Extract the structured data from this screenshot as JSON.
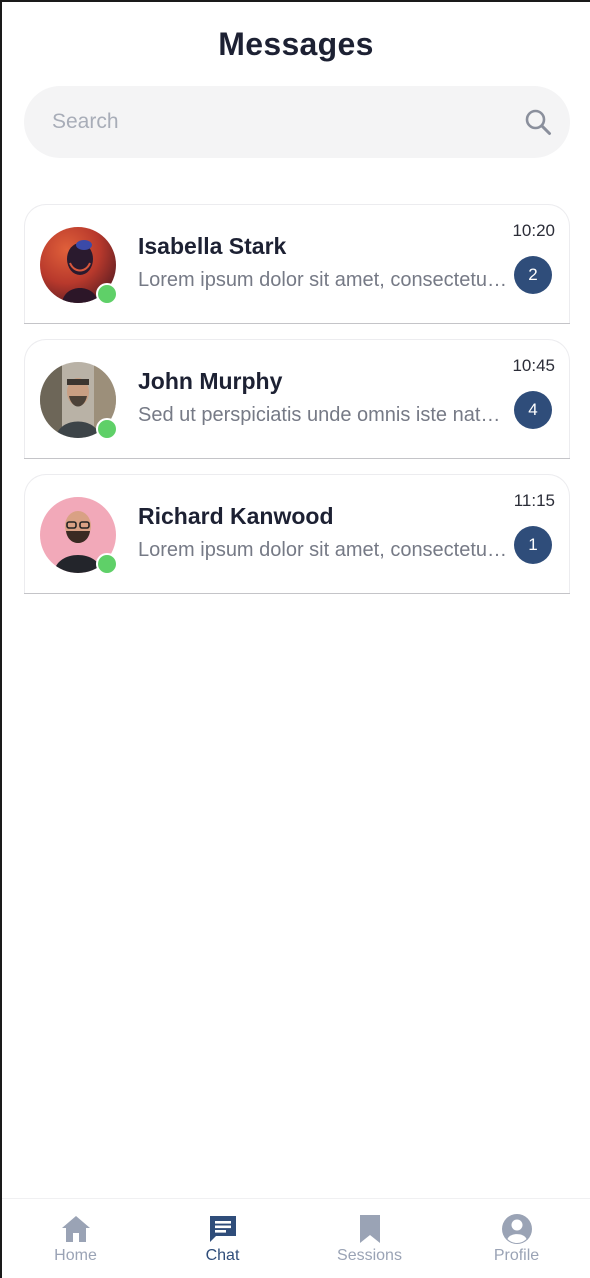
{
  "header": {
    "title": "Messages"
  },
  "search": {
    "placeholder": "Search",
    "value": ""
  },
  "chats": [
    {
      "name": "Isabella Stark",
      "preview": "Lorem ipsum dolor sit amet, consectetur adipiscing elit",
      "time": "10:20",
      "unread": "2",
      "online": true
    },
    {
      "name": "John Murphy",
      "preview": "Sed ut perspiciatis unde omnis iste natus error sit",
      "time": "10:45",
      "unread": "4",
      "online": true
    },
    {
      "name": "Richard Kanwood",
      "preview": "Lorem ipsum dolor sit amet, consectetur adipiscing elit",
      "time": "11:15",
      "unread": "1",
      "online": true
    }
  ],
  "nav": {
    "active": "chat",
    "items": [
      {
        "id": "home",
        "label": "Home",
        "icon": "home-icon"
      },
      {
        "id": "chat",
        "label": "Chat",
        "icon": "chat-icon"
      },
      {
        "id": "sessions",
        "label": "Sessions",
        "icon": "bookmark-icon"
      },
      {
        "id": "profile",
        "label": "Profile",
        "icon": "profile-icon"
      }
    ]
  },
  "colors": {
    "accent": "#2f4d7a",
    "online": "#5fd068",
    "inactive_nav": "#9aa3b5",
    "text_primary": "#1d2133",
    "text_secondary": "#767a86"
  }
}
